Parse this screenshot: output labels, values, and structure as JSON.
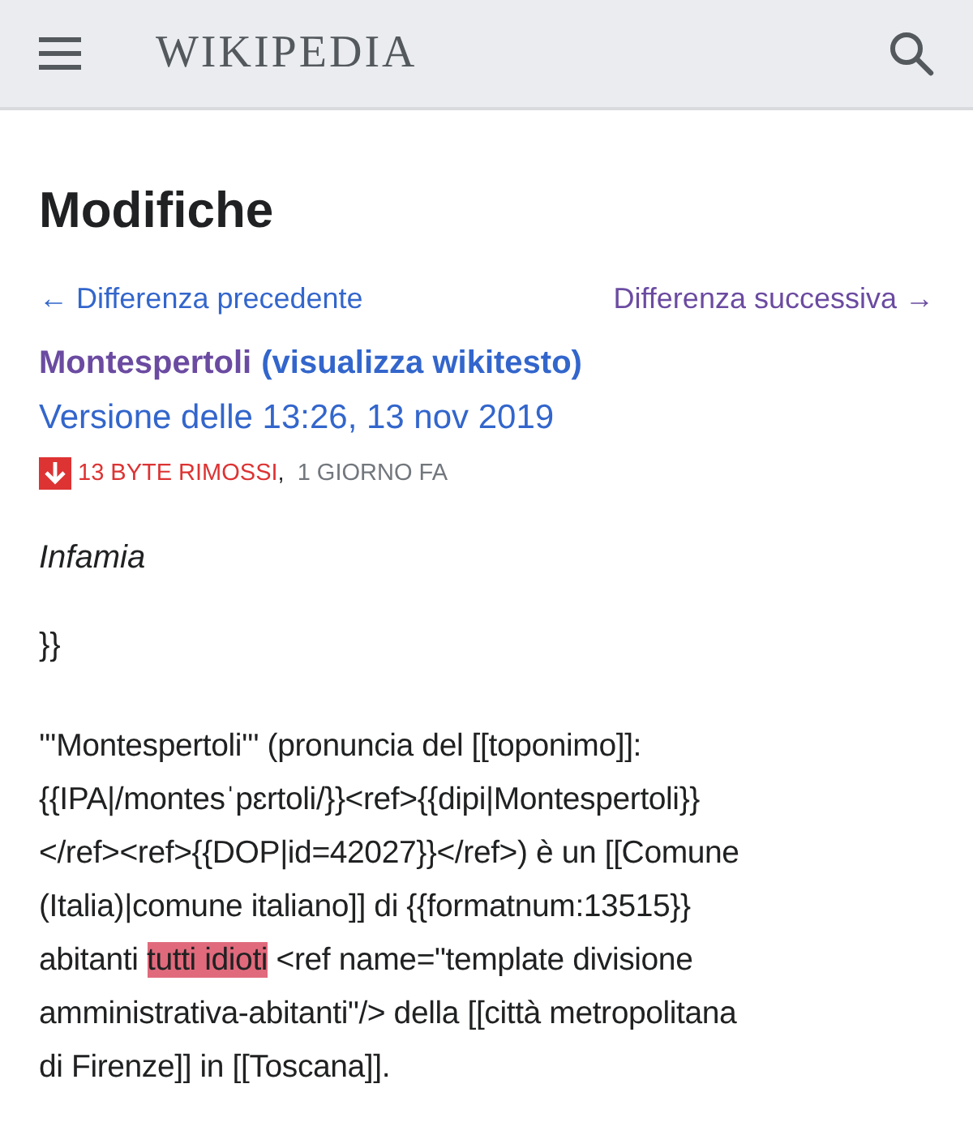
{
  "header": {
    "logo": "WIKIPEDIA"
  },
  "title": "Modifiche",
  "nav": {
    "previous": "← Differenza precedente",
    "next": "Differenza successiva →"
  },
  "page": {
    "name": "Montespertoli",
    "source_link": "(visualizza wikitesto)"
  },
  "revision": "Versione delle 13:26, 13 nov 2019",
  "size_change": {
    "text": "13 BYTE RIMOSSI",
    "separator": ",",
    "age": "1 GIORNO FA"
  },
  "context": [
    "Infamia",
    "}}"
  ],
  "diff_lines": [
    [
      {
        "text": "'''Montespertoli''' (pronuncia del [[toponimo]]:",
        "deleted": false
      }
    ],
    [
      {
        "text": "{{IPA|/montesˈpɛrtoli/}}<ref>{{dipi|Montespertoli}}",
        "deleted": false
      }
    ],
    [
      {
        "text": "</ref><ref>{{DOP|id=42027}}</ref>) è un [[Comune",
        "deleted": false
      }
    ],
    [
      {
        "text": "(Italia)|comune italiano]] di {{formatnum:13515}}",
        "deleted": false
      }
    ],
    [
      {
        "text": "abitanti ",
        "deleted": false
      },
      {
        "text": "tutti idioti",
        "deleted": true
      },
      {
        "text": " <ref name=\"template divisione",
        "deleted": false
      }
    ],
    [
      {
        "text": "amministrativa-abitanti\"/> della [[città metropolitana",
        "deleted": false
      }
    ],
    [
      {
        "text": "di Firenze]] in [[Toscana]].",
        "deleted": false
      }
    ]
  ]
}
